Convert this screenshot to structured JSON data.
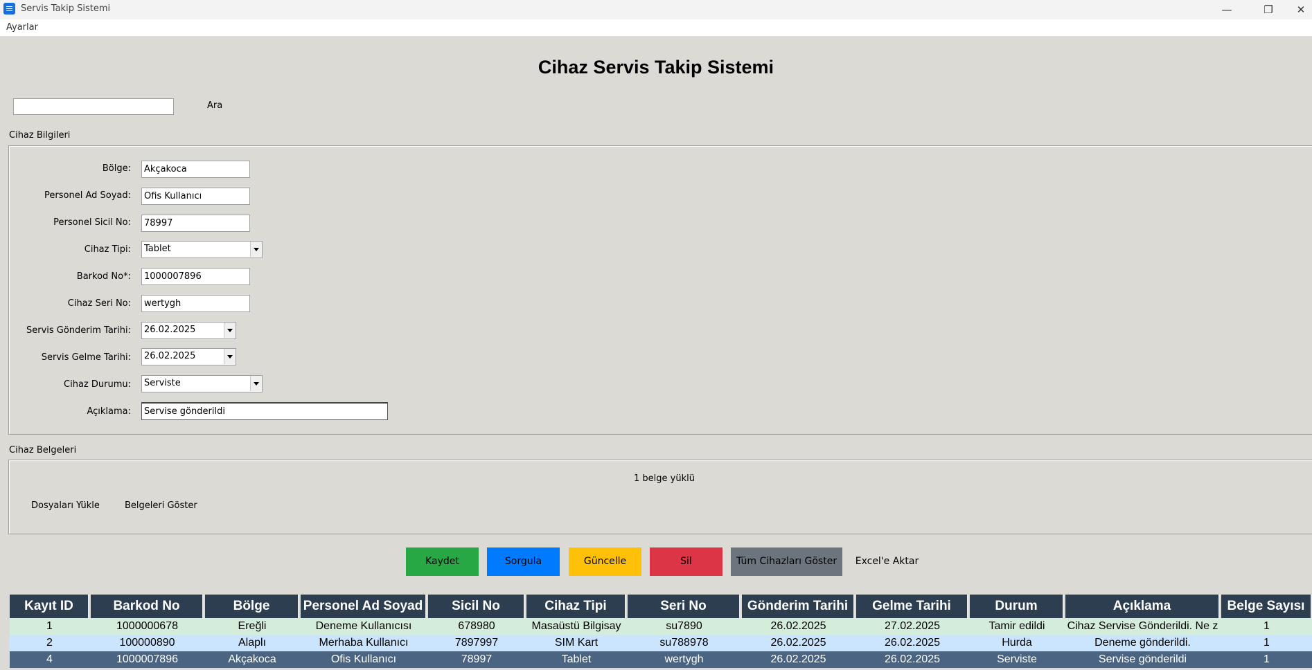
{
  "window": {
    "title": "Servis Takip Sistemi",
    "minimize_glyph": "—",
    "maximize_glyph": "❐",
    "close_glyph": "✕"
  },
  "menu": {
    "settings": "Ayarlar"
  },
  "page": {
    "title": "Cihaz Servis Takip Sistemi"
  },
  "search": {
    "value": "",
    "button": "Ara"
  },
  "device_info": {
    "section_label": "Cihaz Bilgileri",
    "region_label": "Bölge:",
    "region_value": "Akçakoca",
    "name_label": "Personel Ad Soyad:",
    "name_value": "Ofis Kullanıcı",
    "sicil_label": "Personel Sicil No:",
    "sicil_value": "78997",
    "type_label": "Cihaz Tipi:",
    "type_value": "Tablet",
    "barcode_label": "Barkod No*:",
    "barcode_value": "1000007896",
    "serial_label": "Cihaz Seri No:",
    "serial_value": "wertygh",
    "send_date_label": "Servis Gönderim Tarihi:",
    "send_date_value": "26.02.2025",
    "return_date_label": "Servis Gelme Tarihi:",
    "return_date_value": "26.02.2025",
    "status_label": "Cihaz Durumu:",
    "status_value": "Serviste",
    "desc_label": "Açıklama:",
    "desc_value": "Servise gönderildi"
  },
  "documents": {
    "section_label": "Cihaz Belgeleri",
    "status": "1 belge yüklü",
    "upload": "Dosyaları Yükle",
    "show": "Belgeleri Göster"
  },
  "actions": {
    "save": "Kaydet",
    "query": "Sorgula",
    "update": "Güncelle",
    "delete": "Sil",
    "show_all": "Tüm Cihazları Göster",
    "export": "Excel'e Aktar",
    "colors": {
      "save": "#28a745",
      "query": "#007bff",
      "update": "#ffc107",
      "delete": "#dc3545",
      "show_all": "#6c757d"
    }
  },
  "table": {
    "headers": [
      "Kayıt ID",
      "Barkod No",
      "Bölge",
      "Personel Ad Soyad",
      "Sicil No",
      "Cihaz Tipi",
      "Seri No",
      "Gönderim Tarihi",
      "Gelme Tarihi",
      "Durum",
      "Açıklama",
      "Belge Sayısı"
    ],
    "rows": [
      {
        "cells": [
          "1",
          "1000000678",
          "Ereğli",
          "Deneme Kullanıcısı",
          "678980",
          "Masaüstü Bilgisay",
          "su7890",
          "26.02.2025",
          "27.02.2025",
          "Tamir edildi",
          "Cihaz Servise Gönderildi. Ne z",
          "1"
        ],
        "bg": "#d4edda",
        "fg": "#000000"
      },
      {
        "cells": [
          "2",
          "100000890",
          "Alaplı",
          "Merhaba Kullanıcı",
          "7897997",
          "SIM Kart",
          "su788978",
          "26.02.2025",
          "26.02.2025",
          "Hurda",
          "Deneme gönderildi.",
          "1"
        ],
        "bg": "#cce5ff",
        "fg": "#000000"
      },
      {
        "cells": [
          "4",
          "1000007896",
          "Akçakoca",
          "Ofis Kullanıcı",
          "78997",
          "Tablet",
          "wertygh",
          "26.02.2025",
          "26.02.2025",
          "Serviste",
          "Servise gönderildi",
          "1"
        ],
        "bg": "#4a6481",
        "fg": "#ffffff"
      }
    ]
  }
}
